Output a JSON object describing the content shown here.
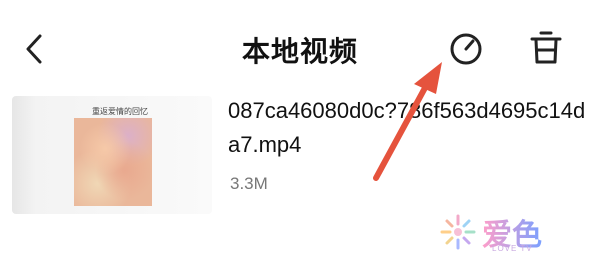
{
  "header": {
    "title": "本地视频",
    "icons": {
      "back": "back-chevron-icon",
      "timer": "timer-icon",
      "delete": "trash-icon"
    }
  },
  "video": {
    "thumbnail_caption": "重返爱情的回忆",
    "filename": "087ca46080d0c?786f563d4695c14da7.mp4",
    "size": "3.3M"
  },
  "watermark": {
    "logo_text": "爱色",
    "subtitle": "LOVE TV"
  },
  "colors": {
    "arrow": "#e5533d",
    "text": "#111111",
    "secondary_text": "#777777"
  }
}
